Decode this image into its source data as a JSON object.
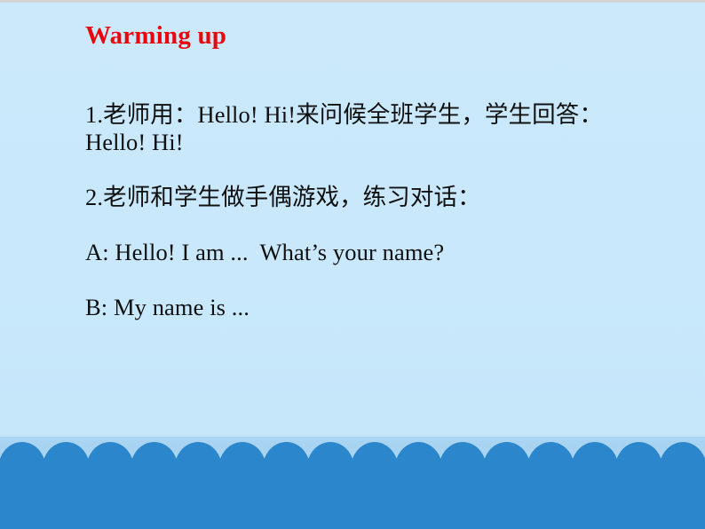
{
  "slide": {
    "title": "Warming up",
    "title_color": "#e8070d",
    "background_top_color": "#cbe9fb",
    "background_bottom_color": "#c3e4fa",
    "body_text_color": "#101010",
    "lines": [
      "1.老师用：Hello! Hi!来问候全班学生，学生回答：",
      "Hello! Hi!",
      "2.老师和学生做手偶游戏，练习对话：",
      "A: Hello! I am ...  What’s your name?",
      "B: My name is ..."
    ]
  },
  "decoration": {
    "name": "scalloped-dome-border",
    "band_color": "#a9d4f2",
    "dome_color": "#2b86cc",
    "dome_count_top": 16,
    "dome_count_bottom": 17,
    "rows": 2
  }
}
